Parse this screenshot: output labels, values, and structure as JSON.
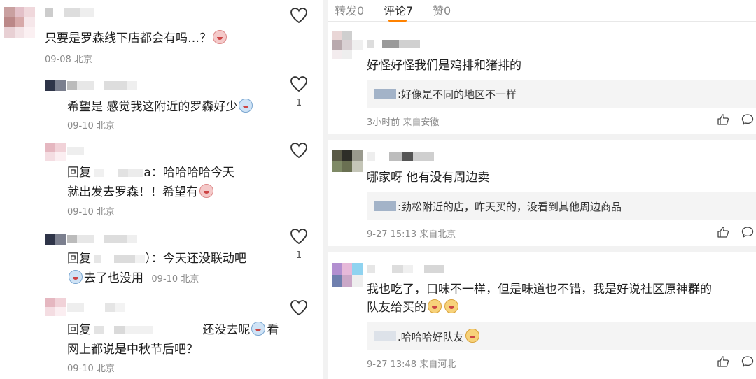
{
  "left_panel": {
    "comments": [
      {
        "text_line1": "只要是罗森线下店都会有吗…？",
        "date": "09-08",
        "location": "北京",
        "likes": ""
      },
      {
        "text_line1": "希望是 感觉我这附近的罗森好少",
        "date": "09-10",
        "location": "北京",
        "likes": "1"
      },
      {
        "reply_prefix": "回复",
        "text_line1": "a：哈哈哈哈今天",
        "text_line2": "就出发去罗森！！希望有",
        "date": "09-10",
        "location": "北京",
        "likes": ""
      },
      {
        "reply_prefix": "回复",
        "text_line1": "）：今天还没联动吧",
        "text_line2": "去了也没用",
        "date": "09-10",
        "location": "北京",
        "likes": "1"
      },
      {
        "reply_prefix": "回复",
        "text_line1": "还没去呢",
        "text_line1b": "看",
        "text_line2": "网上都说是中秋节后吧？",
        "date": "09-10",
        "location": "北京",
        "likes": ""
      }
    ]
  },
  "right_panel": {
    "tabs": [
      {
        "label": "转发0"
      },
      {
        "label": "评论7"
      },
      {
        "label": "赞0"
      }
    ],
    "comments": [
      {
        "text": "好怪好怪我们是鸡排和猪排的",
        "reply": ":好像是不同的地区不一样",
        "time": "3小时前",
        "source": "来自安徽"
      },
      {
        "text": "哪家呀 他有没有周边卖",
        "reply": ":劲松附近的店，昨天买的，没看到其他周边商品",
        "time": "9-27 15:13",
        "source": "来自北京"
      },
      {
        "text_line1": "我也吃了，口味不一样，但是味道也不错，我是好说社区原神群的",
        "text_line2": "队友给买的",
        "reply": ".哈哈哈好队友",
        "time": "9-27 13:48",
        "source": "来自河北"
      }
    ]
  },
  "colors": {
    "accent": "#ff8200",
    "meta": "#8a8a8a",
    "quote_bg": "#f4f4f4",
    "separator": "#f2f2f2"
  },
  "icons": {
    "like_left": "heart-outline-icon",
    "like_right": "thumbs-up-icon",
    "comment_right": "comment-bubble-icon"
  }
}
